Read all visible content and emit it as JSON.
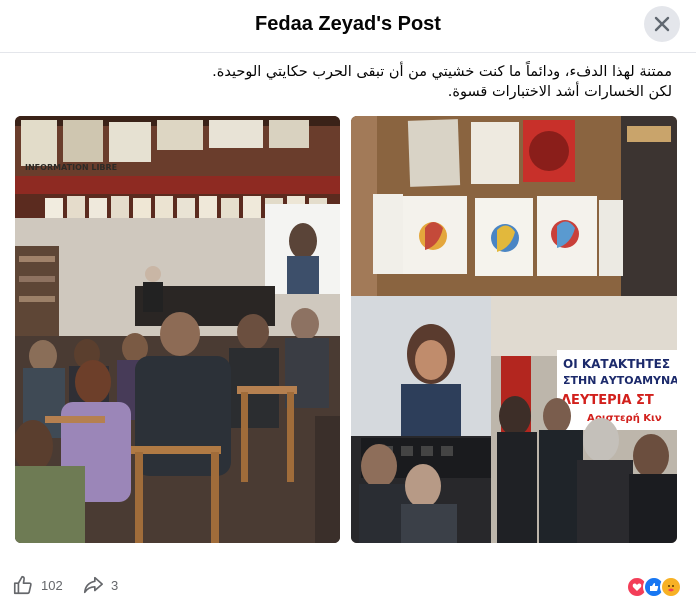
{
  "header": {
    "title": "Fedaa Zeyad's Post"
  },
  "post": {
    "line_1": "ممتنة لهذا الدفء، ودائماً ما كنت خشيتي من أن تبقى الحرب حكايتي الوحيدة.",
    "line_2": "لكن الخسارات أشد الاختبارات قسوة."
  },
  "photos": {
    "banner_sign": "INFORMATION LIBRE",
    "protest_sign_line_1": "ΟΙ ΚΑΤΑΚΤΗΤΕΣ",
    "protest_sign_line_2": "ΣΤΗΝ ΑΥΤΟΑΜΥΝΑ",
    "protest_sign_line_3": "ΛΕΥΤΕΡΙΑ ΣΤ",
    "protest_sign_line_4": "Αριστερή Κιν"
  },
  "footer": {
    "like_count": "102",
    "share_count": "3",
    "reaction_icons": [
      "love-icon",
      "like-icon",
      "care-icon"
    ]
  },
  "colors": {
    "brand_blue": "#1877f2",
    "love_red": "#f33e58",
    "care_yellow": "#f7b125",
    "text_secondary": "#65676b"
  }
}
